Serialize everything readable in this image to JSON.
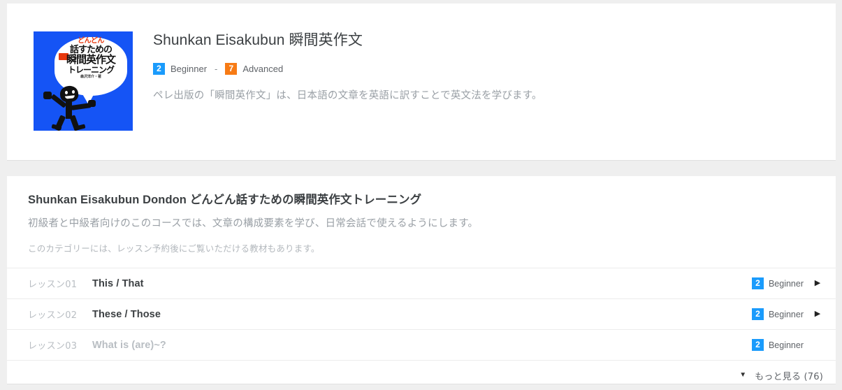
{
  "book": {
    "title_en": "Shunkan Eisakubun",
    "title_jp": "瞬間英作文",
    "cover": {
      "line1": "どんどん",
      "badge_text": "超英語",
      "line2": "話すための",
      "line3": "瞬間英作文",
      "line4": "トレーニング",
      "author": "森沢洋介・著",
      "bg_color": "#1554f5"
    },
    "level_from": {
      "number": "2",
      "name": "Beginner",
      "color": "#1a9bfc"
    },
    "level_separator": "-",
    "level_to": {
      "number": "7",
      "name": "Advanced",
      "color": "#f77b15"
    },
    "description": "ペレ出版の「瞬間英作文」は、日本語の文章を英語に訳すことで英文法を学びます。"
  },
  "course": {
    "title_en": "Shunkan Eisakubun Dondon",
    "title_jp": "どんどん話すための瞬間英作文トレーニング",
    "description": "初級者と中級者向けのこのコースでは、文章の構成要素を学び、日常会話で使えるようにします。",
    "note": "このカテゴリーには、レッスン予約後にご覧いただける教材もあります。",
    "lessons": [
      {
        "number": "レッスン01",
        "title": "This / That",
        "level_number": "2",
        "level_name": "Beginner",
        "level_color": "#1a9bfc",
        "arrow": "▶",
        "disabled": false
      },
      {
        "number": "レッスン02",
        "title": "These / Those",
        "level_number": "2",
        "level_name": "Beginner",
        "level_color": "#1a9bfc",
        "arrow": "▶",
        "disabled": false
      },
      {
        "number": "レッスン03",
        "title": "What is (are)~?",
        "level_number": "2",
        "level_name": "Beginner",
        "level_color": "#1a9bfc",
        "arrow": "▶",
        "disabled": true
      }
    ],
    "more": {
      "caret": "▼",
      "label": "もっと見る (76)"
    }
  }
}
